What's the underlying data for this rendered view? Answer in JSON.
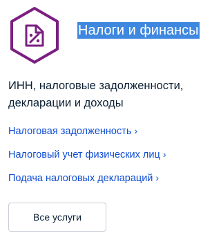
{
  "category": {
    "icon": "tax-document-icon",
    "title": "Налоги и финансы",
    "description": "ИНН, налоговые задолженности, декларации и доходы",
    "accent_color": "#7b1f82"
  },
  "links": [
    {
      "label": "Налоговая задолженность",
      "chevron": "›"
    },
    {
      "label": "Налоговый учет физических лиц",
      "chevron": "›"
    },
    {
      "label": "Подача налоговых деклараций",
      "chevron": "›"
    }
  ],
  "colors": {
    "link": "#0d4cd3",
    "text": "#0b1f33",
    "selection_bg": "#3e88e0"
  },
  "actions": {
    "all_services_label": "Все услуги"
  }
}
